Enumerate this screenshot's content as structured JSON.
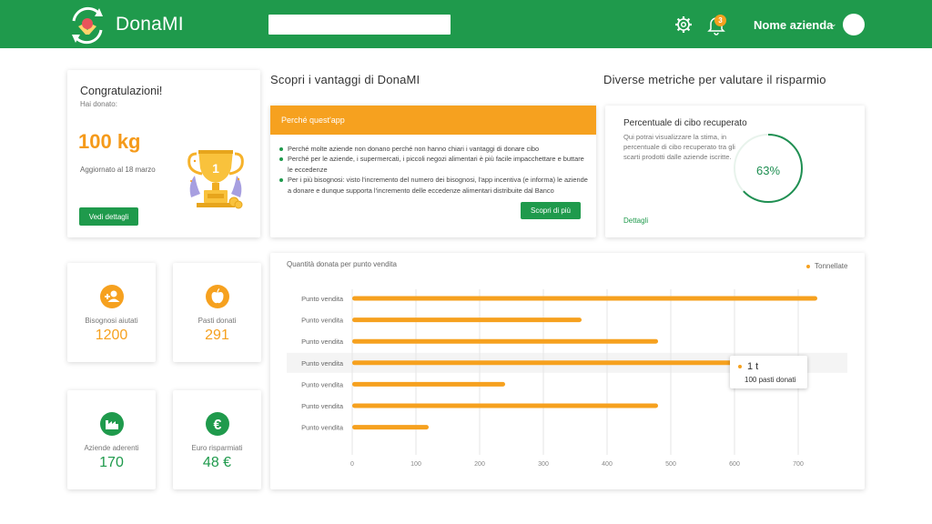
{
  "app": {
    "name": "DonaMI"
  },
  "header": {
    "company_name": "Nome azienda",
    "notifications_count": "3"
  },
  "congrats": {
    "title": "Congratulazioni!",
    "subtitle": "Hai donato:",
    "amount": "100 kg",
    "updated": "Aggiornato al 18 marzo",
    "button": "Vedi dettagli"
  },
  "benefits": {
    "section_title": "Scopri i vantaggi di DonaMI",
    "card_title": "Perché quest'app",
    "items": [
      "Perché molte aziende non donano perché non hanno chiari i vantaggi di donare cibo",
      "Perché per le aziende, i supermercati, i piccoli negozi alimentari è più facile impacchettare e buttare le eccedenze",
      "Per i più bisognosi: visto l'incremento del numero dei bisognosi, l'app incentiva (e informa) le aziende a donare e dunque supporta l'incremento delle eccedenze alimentari distribuite dal Banco"
    ],
    "button": "Scopri di più"
  },
  "metrics": {
    "section_title": "Diverse metriche per valutare il risparmio",
    "card_title": "Percentuale di cibo recuperato",
    "description": "Qui potrai visualizzare la stima, in percentuale di cibo recuperato tra gli scarti prodotti dalle aziende iscritte.",
    "link": "Dettagli",
    "percent_value": 63,
    "percent_label": "63%"
  },
  "stats": [
    {
      "label": "Bisognosi aiutati",
      "value": "1200",
      "icon": "people-add-icon",
      "color": "#f6a11f"
    },
    {
      "label": "Pasti donati",
      "value": "291",
      "icon": "apple-icon",
      "color": "#f6a11f"
    },
    {
      "label": "Aziende aderenti",
      "value": "170",
      "icon": "factory-icon",
      "color": "#1f9a4c"
    },
    {
      "label": "Euro risparmiati",
      "value": "48 €",
      "icon": "euro-icon",
      "color": "#1f9a4c"
    }
  ],
  "chart": {
    "title": "Quantità donata per punto vendita",
    "legend": "Tonnellate",
    "tooltip": {
      "value": "1 t",
      "label": "100 pasti donati"
    }
  },
  "colors": {
    "green": "#1f9a4c",
    "orange": "#f6a11f"
  },
  "chart_data": {
    "type": "bar",
    "orientation": "horizontal",
    "title": "Quantità donata per punto vendita",
    "categories": [
      "Punto vendita",
      "Punto vendita",
      "Punto vendita",
      "Punto vendita",
      "Punto vendita",
      "Punto vendita",
      "Punto vendita"
    ],
    "series": [
      {
        "name": "Tonnellate",
        "values": [
          730,
          360,
          480,
          610,
          240,
          480,
          120
        ]
      }
    ],
    "x_ticks": [
      "0",
      "100",
      "200",
      "300",
      "400",
      "500",
      "600",
      "700"
    ],
    "xlim": [
      0,
      700
    ],
    "grid": true,
    "legend_position": "top-right",
    "highlighted_index": 3
  }
}
